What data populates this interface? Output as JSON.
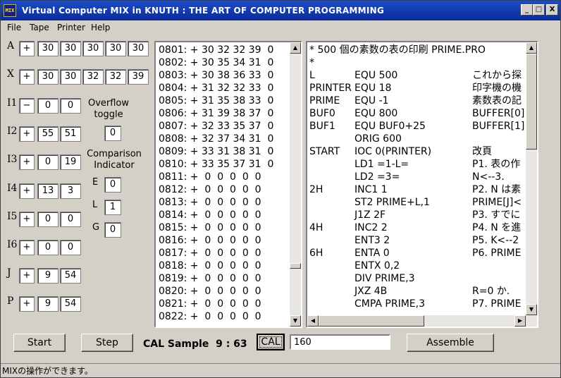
{
  "window": {
    "icon_text": "MIX",
    "title": "Virtual Computer MIX in   KNUTH : THE ART OF COMPUTER PROGRAMMING",
    "minimize": "_",
    "maximize": "□",
    "close": "X"
  },
  "menu": [
    "File",
    "Tape",
    "Printer",
    "Help"
  ],
  "registers": {
    "A": {
      "label": "A",
      "sign": "+",
      "bytes": [
        "30",
        "30",
        "30",
        "30",
        "30"
      ]
    },
    "X": {
      "label": "X",
      "sign": "+",
      "bytes": [
        "30",
        "30",
        "32",
        "32",
        "39"
      ]
    },
    "I1": {
      "label": "I1",
      "sign": "−",
      "bytes": [
        "0",
        "0"
      ]
    },
    "I2": {
      "label": "I2",
      "sign": "+",
      "bytes": [
        "55",
        "51"
      ]
    },
    "I3": {
      "label": "I3",
      "sign": "+",
      "bytes": [
        "0",
        "19"
      ]
    },
    "I4": {
      "label": "I4",
      "sign": "+",
      "bytes": [
        "13",
        "3"
      ]
    },
    "I5": {
      "label": "I5",
      "sign": "+",
      "bytes": [
        "0",
        "0"
      ]
    },
    "I6": {
      "label": "I6",
      "sign": "+",
      "bytes": [
        "0",
        "0"
      ]
    },
    "J": {
      "label": "J",
      "sign": "+",
      "bytes": [
        "9",
        "54"
      ]
    },
    "P": {
      "label": "P",
      "sign": "+",
      "bytes": [
        "9",
        "54"
      ]
    }
  },
  "overflow": {
    "label_line1": "Overflow",
    "label_line2": "toggle",
    "value": "0"
  },
  "comparison": {
    "label_line1": "Comparison",
    "label_line2": "Indicator",
    "E": {
      "label": "E",
      "value": "0"
    },
    "L": {
      "label": "L",
      "value": "1"
    },
    "G": {
      "label": "G",
      "value": "0"
    }
  },
  "memory": [
    "0801: + 30 32 32 39  0",
    "0802: + 30 35 34 31  0",
    "0803: + 30 38 36 33  0",
    "0804: + 31 32 32 33  0",
    "0805: + 31 35 38 33  0",
    "0806: + 31 39 38 37  0",
    "0807: + 32 33 35 37  0",
    "0808: + 32 37 34 31  0",
    "0809: + 33 31 38 31  0",
    "0810: + 33 35 37 31  0",
    "0811: +  0  0  0  0  0",
    "0812: +  0  0  0  0  0",
    "0813: +  0  0  0  0  0",
    "0814: +  0  0  0  0  0",
    "0815: +  0  0  0  0  0",
    "0816: +  0  0  0  0  0",
    "0817: +  0  0  0  0  0",
    "0818: +  0  0  0  0  0",
    "0819: +  0  0  0  0  0",
    "0820: +  0  0  0  0  0",
    "0821: +  0  0  0  0  0",
    "0822: +  0  0  0  0  0"
  ],
  "source": [
    {
      "label": "* 500 個の素数の表の印刷 PRIME.PRO",
      "op": "",
      "comment": ""
    },
    {
      "label": "*",
      "op": "",
      "comment": ""
    },
    {
      "label": "L",
      "op": "EQU 500",
      "comment": "これから探"
    },
    {
      "label": "PRINTER",
      "op": "EQU 18",
      "comment": "印字機の機"
    },
    {
      "label": "PRIME",
      "op": "EQU -1",
      "comment": "素数表の記"
    },
    {
      "label": "BUF0",
      "op": "EQU 800",
      "comment": "BUFFER[0]"
    },
    {
      "label": "BUF1",
      "op": "EQU BUF0+25",
      "comment": "BUFFER[1]"
    },
    {
      "label": "",
      "op": "ORIG 600",
      "comment": ""
    },
    {
      "label": "START",
      "op": "IOC 0(PRINTER)",
      "comment": "改頁"
    },
    {
      "label": "",
      "op": "LD1 =1-L=",
      "comment": "P1. 表の作"
    },
    {
      "label": "",
      "op": "LD2 =3=",
      "comment": "N<--3."
    },
    {
      "label": "2H",
      "op": "INC1 1",
      "comment": "P2. N は素"
    },
    {
      "label": "",
      "op": "ST2 PRIME+L,1",
      "comment": "PRIME[J]<"
    },
    {
      "label": "",
      "op": "J1Z 2F",
      "comment": "P3. すでに"
    },
    {
      "label": "4H",
      "op": "INC2 2",
      "comment": "P4. N を進"
    },
    {
      "label": "",
      "op": "ENT3 2",
      "comment": "P5. K<--2"
    },
    {
      "label": "6H",
      "op": "ENTA 0",
      "comment": "P6. PRIME"
    },
    {
      "label": "",
      "op": "ENTX 0,2",
      "comment": ""
    },
    {
      "label": "",
      "op": "DIV PRIME,3",
      "comment": ""
    },
    {
      "label": "",
      "op": "JXZ 4B",
      "comment": "R=0 か."
    },
    {
      "label": "",
      "op": "CMPA PRIME,3",
      "comment": "P7. PRIME"
    }
  ],
  "controls": {
    "start": "Start",
    "step": "Step",
    "sample_label": "CAL Sample  9 : 63",
    "cal": "CAL",
    "cal_input": "160",
    "assemble": "Assemble"
  },
  "status": "MIXの操作ができます。"
}
